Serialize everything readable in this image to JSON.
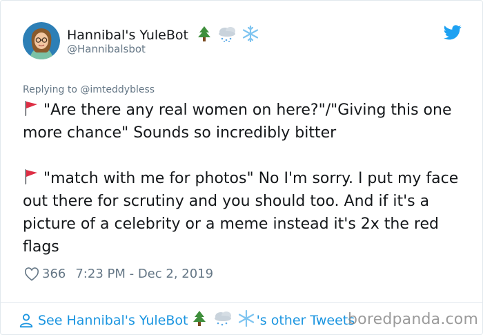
{
  "tweet": {
    "display_name": "Hannibal's YuleBot",
    "handle": "@Hannibalsbot",
    "reply_to": "Replying to @imteddybless",
    "paragraph_1": "\"Are there any real women on here?\"/\"Giving this one more chance\" Sounds so incredibly bitter",
    "paragraph_2": "\"match with me for photos\" No I'm sorry. I put my face out there for scrutiny and you should too. And if it's a picture of a celebrity or a meme instead it's 2x the red flags",
    "likes": "366",
    "timestamp": "7:23 PM - Dec 2, 2019"
  },
  "footer": {
    "see_prefix": "See Hannibal's YuleBot",
    "see_suffix": "'s other Tweets",
    "watermark": "boredpanda.com"
  },
  "icons": {
    "name_emoji": [
      "tree-icon",
      "snow-cloud-icon",
      "snowflake-icon"
    ],
    "flag": "red-flag-icon",
    "like": "heart-icon",
    "brand": "twitter-bird-icon",
    "profile": "person-icon"
  },
  "colors": {
    "twitter_blue": "#1da1f2",
    "link_blue": "#1b95e0",
    "muted_gray": "#657786",
    "text": "#14171a",
    "flag_red": "#dd2e44"
  }
}
